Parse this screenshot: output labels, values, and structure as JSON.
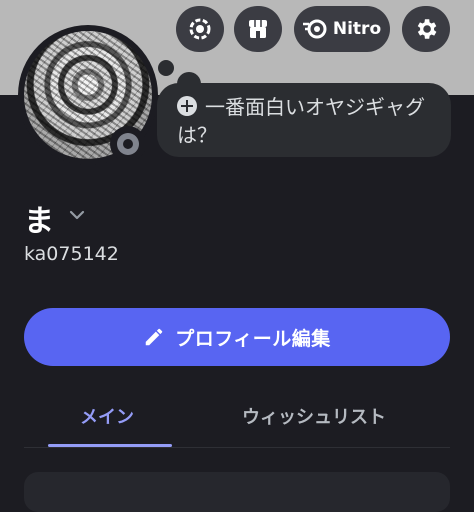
{
  "header": {
    "nitro_label": "Nitro",
    "icons": [
      "quests-icon",
      "shop-icon",
      "nitro-icon",
      "settings-icon"
    ]
  },
  "status_prompt": {
    "text": "一番面白いオヤジギャグは？"
  },
  "profile": {
    "display_name": "ま",
    "username": "ka075142",
    "status": "offline"
  },
  "edit_button": {
    "label": "プロフィール編集"
  },
  "tabs": [
    {
      "label": "メイン",
      "active": true
    },
    {
      "label": "ウィッシュリスト",
      "active": false
    }
  ],
  "colors": {
    "accent": "#5865f2",
    "tab_active": "#949cf7",
    "background": "#1c1c22",
    "banner": "#b8b8b8"
  }
}
